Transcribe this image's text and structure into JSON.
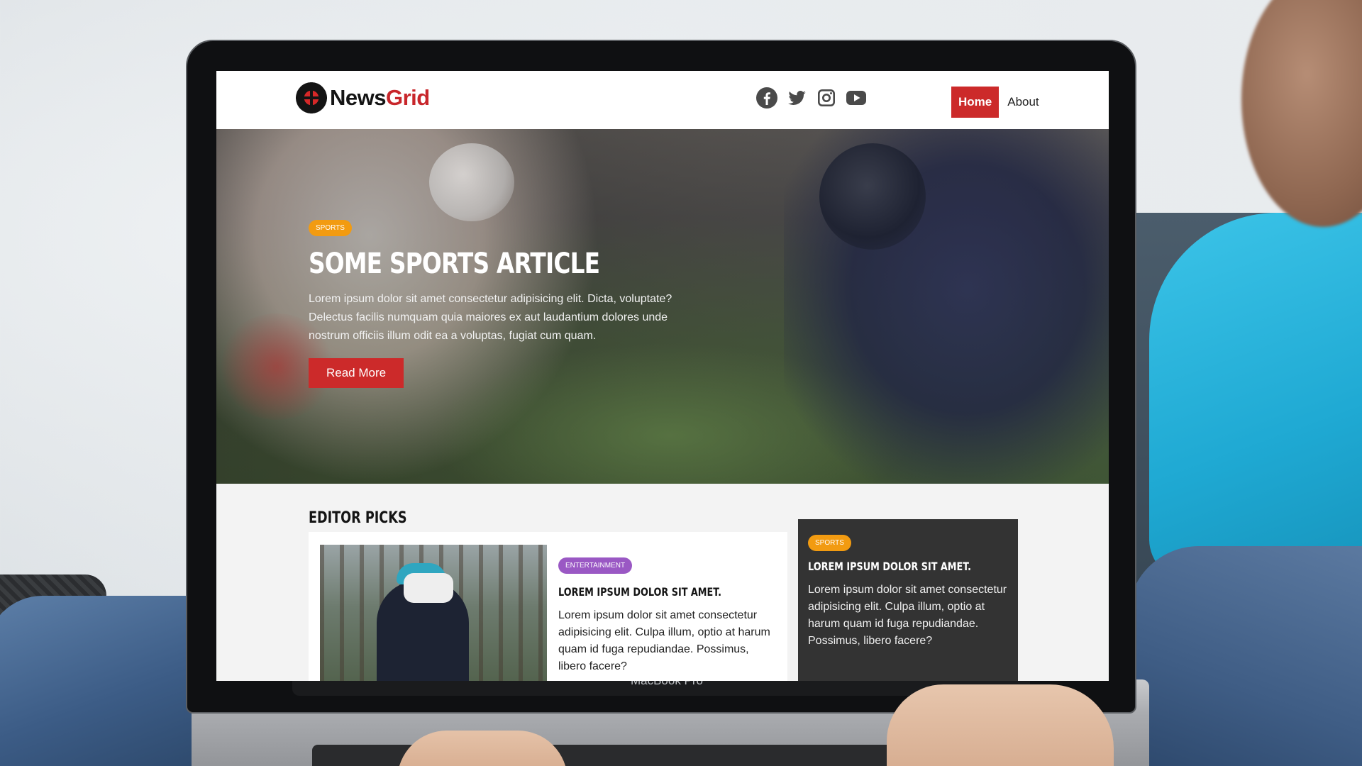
{
  "site": {
    "logo_part1": "News",
    "logo_part2": "Grid",
    "socials": [
      "facebook-icon",
      "twitter-icon",
      "instagram-icon",
      "youtube-icon"
    ],
    "nav": {
      "home": "Home",
      "about": "About"
    }
  },
  "hero": {
    "category": "SPORTS",
    "title": "SOME SPORTS ARTICLE",
    "text": "Lorem ipsum dolor sit amet consectetur adipisicing elit. Dicta, voluptate? Delectus facilis numquam quia maiores ex aut laudantium dolores unde nostrum officiis illum odit ea a voluptas, fugiat cum quam.",
    "button": "Read More"
  },
  "editor_picks": {
    "heading": "EDITOR PICKS",
    "cards": [
      {
        "category": "ENTERTAINMENT",
        "title": "LOREM IPSUM DOLOR SIT AMET.",
        "text": "Lorem ipsum dolor sit amet consectetur adipisicing elit. Culpa illum, optio at harum quam id fuga repudiandae. Possimus, libero facere?"
      },
      {
        "category": "SPORTS",
        "title": "LOREM IPSUM DOLOR SIT AMET.",
        "text": "Lorem ipsum dolor sit amet consectetur adipisicing elit. Culpa illum, optio at harum quam id fuga repudiandae. Possimus, libero facere?"
      }
    ]
  },
  "device_label": "MacBook Pro",
  "colors": {
    "brand_red": "#cc2a2a",
    "sports_badge": "#f29b11",
    "entertainment_badge": "#9a58c4",
    "dark_card": "#333333"
  }
}
